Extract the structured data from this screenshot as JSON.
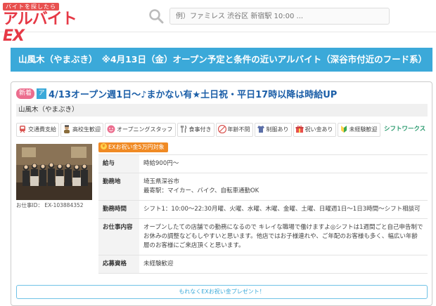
{
  "header": {
    "logo_tag": "バイトを探したら",
    "logo_main": "アルバイト",
    "logo_ex": "EX",
    "search_placeholder": "例）ファミレス 渋谷区 新宿駅 10:00 ..."
  },
  "banner": {
    "text": "山風木（やまぶき）　※4月13日（金）オープン予定と条件の近いアルバイト（深谷市付近のフード系）"
  },
  "job": {
    "badge_new": "新着",
    "badge_type": "ア",
    "title": "4/13オープン週1日〜♪まかない有★土日祝・平日17時以降は時給UP",
    "company": "山風木（やまぶき）",
    "tags": [
      {
        "icon": "train-icon",
        "label": "交通費支給",
        "color": "#d9534f"
      },
      {
        "icon": "student-icon",
        "label": "高校生歓迎",
        "color": "#8a6d3b"
      },
      {
        "icon": "smile-icon",
        "label": "オープニングスタッフ",
        "color": "#ec6d8e"
      },
      {
        "icon": "fork-icon",
        "label": "食事付き",
        "color": "#777777"
      },
      {
        "icon": "age-icon",
        "label": "年齢不問",
        "color": "#d9534f"
      },
      {
        "icon": "uniform-icon",
        "label": "制服あり",
        "color": "#5b6fa8"
      },
      {
        "icon": "gift-icon",
        "label": "祝い金あり",
        "color": "#e8504f"
      },
      {
        "icon": "beginner-icon",
        "label": "未経験歓迎",
        "color": "#3ba94f"
      }
    ],
    "shiftworks_logo": "シフトワークス",
    "job_id": "お仕事ID： EX-103884352",
    "ex_badge": "EXお祝い金5万円対象",
    "ex_coin": "¥",
    "details": [
      {
        "key": "給与",
        "value": "時給900円〜"
      },
      {
        "key": "勤務地",
        "value": "埼玉県深谷市",
        "value2": "最寄駅：マイカー、バイク、自転車通勤OK"
      },
      {
        "key": "勤務時間",
        "value": "シフト1：10:00〜22:30月曜、火曜、水曜、木曜、金曜、土曜、日曜週1日〜1日3時間〜シフト相談可"
      },
      {
        "key": "お仕事内容",
        "value": "オープンしたての店舗での勤務になるので キレイな職場で働けますよ◎シフトは1週間ごと自己申告制でお休みの調整などもしやすいと思います。他店ではお子様連れや、ご年配のお客様も多く、幅広い年齢層のお客様にご来店頂くと思います。"
      },
      {
        "key": "応募資格",
        "value": "未経験歓迎"
      }
    ],
    "present_text": "もれなくEXお祝い金プレゼント！"
  }
}
